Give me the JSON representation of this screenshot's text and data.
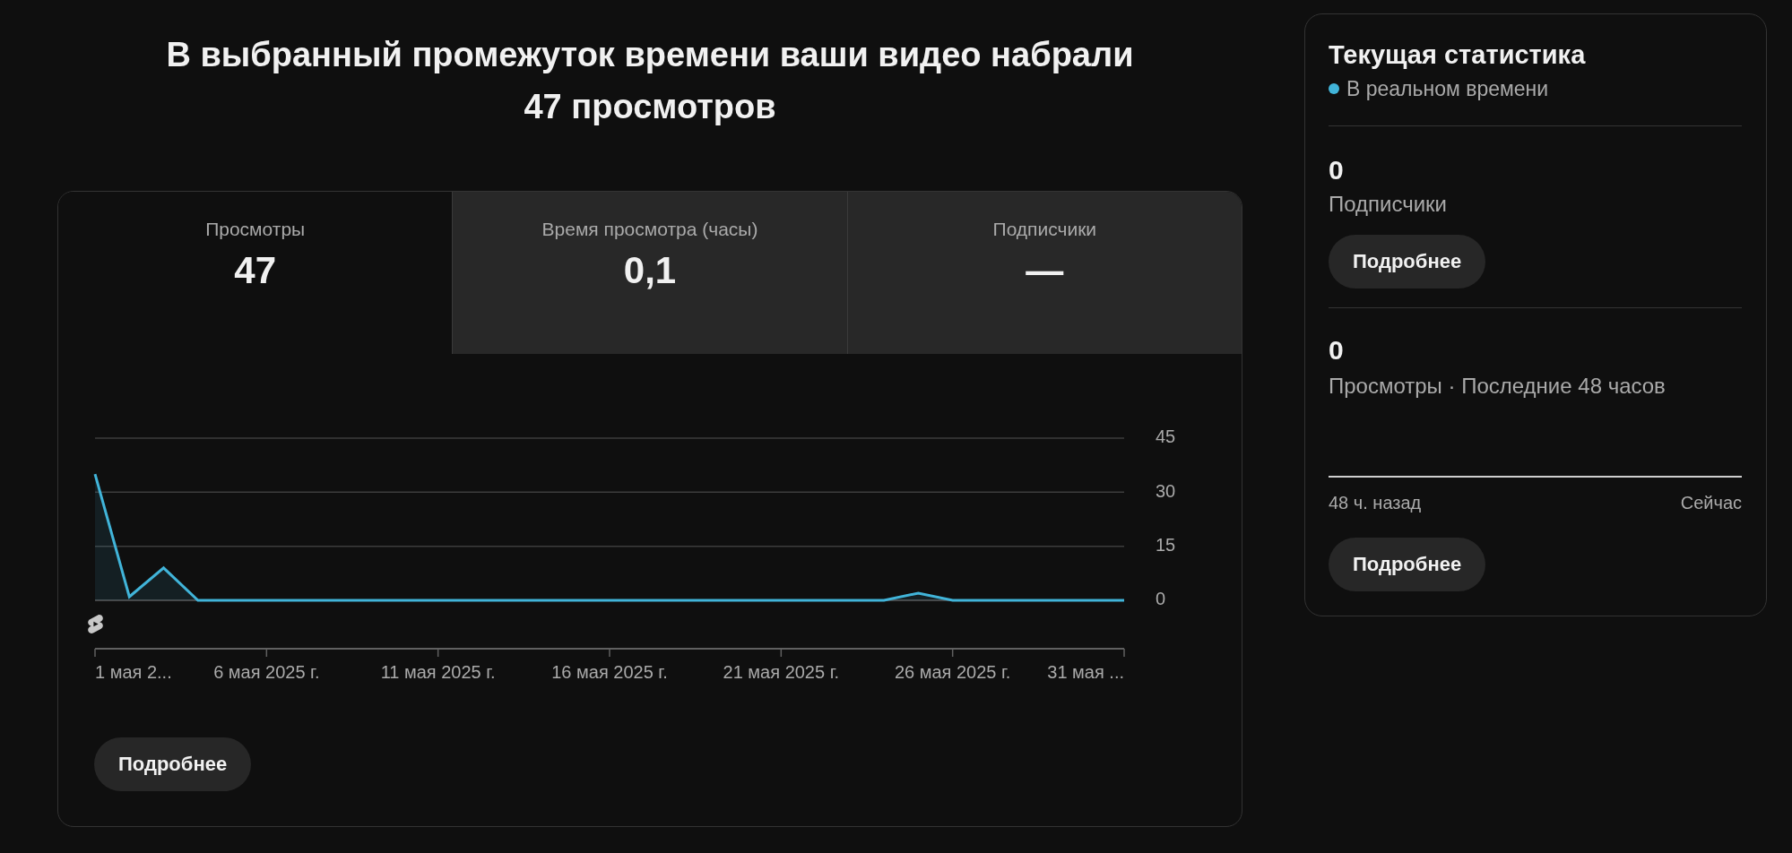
{
  "headline": "В выбранный промежуток времени ваши видео набрали 47 просмотров",
  "metric_tabs": [
    {
      "label": "Просмотры",
      "value": "47",
      "selected": true
    },
    {
      "label": "Время просмотра (часы)",
      "value": "0,1",
      "selected": false
    },
    {
      "label": "Подписчики",
      "value": "—",
      "selected": false
    }
  ],
  "views_chart": {
    "axis_start_label": "1 мая 2...",
    "axis_end_label": "31 мая ...",
    "chart_data": {
      "type": "area",
      "categories": [
        null,
        null,
        null,
        null,
        null,
        "6 мая 2025 г.",
        null,
        null,
        null,
        null,
        "11 мая 2025 г.",
        null,
        null,
        null,
        null,
        "16 мая 2025 г.",
        null,
        null,
        null,
        null,
        "21 мая 2025 г.",
        null,
        null,
        null,
        null,
        "26 мая 2025 г.",
        null,
        null,
        null,
        null,
        null
      ],
      "ylim": [
        0,
        45
      ],
      "yticks": [
        0,
        15,
        30,
        45
      ],
      "series": [
        {
          "color": "#41b4d9",
          "values": [
            35,
            1,
            9,
            0,
            0,
            0,
            0,
            0,
            0,
            0,
            0,
            0,
            0,
            0,
            0,
            0,
            0,
            0,
            0,
            0,
            0,
            0,
            0,
            0,
            2,
            0,
            0,
            0,
            0,
            0,
            0
          ]
        }
      ]
    }
  },
  "details_button": "Подробнее",
  "realtime": {
    "title": "Текущая статистика",
    "live_label": "В реальном времени",
    "sections": [
      {
        "kind": "counter",
        "value": "0",
        "label": "Подписчики",
        "button": "Подробнее"
      },
      {
        "kind": "sparkline",
        "value": "0",
        "label": "Просмотры · Последние 48 часов",
        "range_start": "48 ч. назад",
        "range_end": "Сейчас",
        "button": "Подробнее"
      }
    ]
  }
}
